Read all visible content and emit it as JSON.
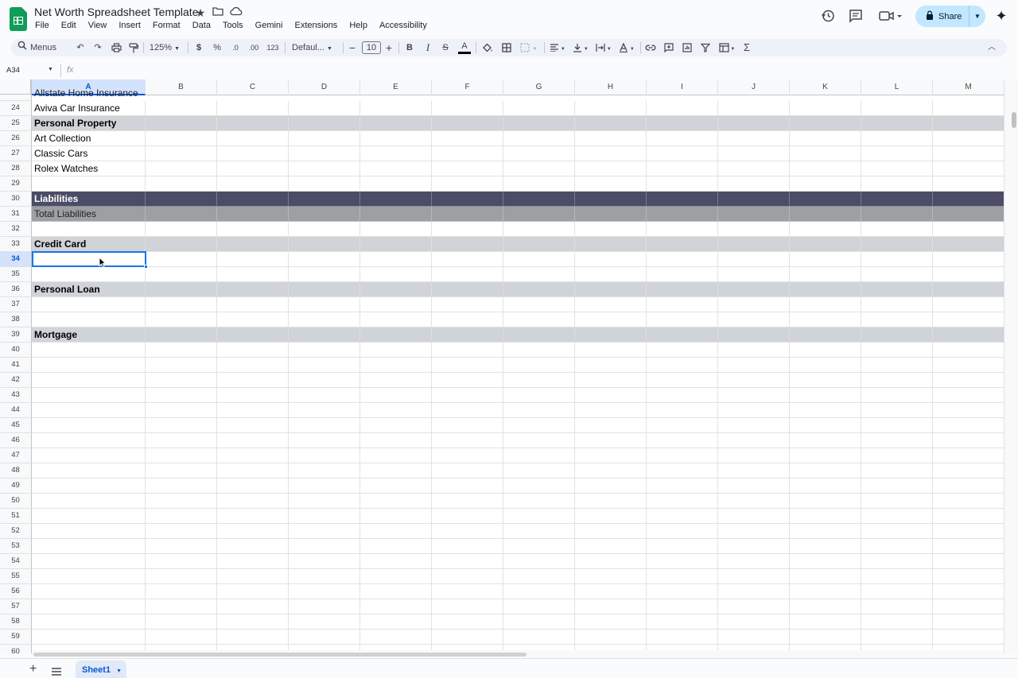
{
  "doc": {
    "title": "Net Worth Spreadsheet Template",
    "menus": [
      "File",
      "Edit",
      "View",
      "Insert",
      "Format",
      "Data",
      "Tools",
      "Gemini",
      "Extensions",
      "Help",
      "Accessibility"
    ],
    "share_label": "Share"
  },
  "icons": {
    "star": "★",
    "folder": "▭",
    "cloud": "☁",
    "history": "⟲",
    "comments": "▤",
    "video": "▶",
    "lock": "🔒",
    "gemini": "✦"
  },
  "toolbar": {
    "search_placeholder": "Menus",
    "zoom": "125%",
    "currency": "$",
    "percent": "%",
    "decrease_decimal": ".0",
    "increase_decimal": ".00",
    "number_format": "123",
    "font": "Defaul...",
    "font_size": "10",
    "bold": "B",
    "italic": "I",
    "strikethrough": "S",
    "text_color": "A"
  },
  "formula_bar": {
    "name_box": "A34",
    "fx": "fx",
    "value": ""
  },
  "grid": {
    "columns": [
      "A",
      "B",
      "C",
      "D",
      "E",
      "F",
      "G",
      "H",
      "I",
      "J",
      "K",
      "L",
      "M"
    ],
    "selected_column": "A",
    "selected_row": "34",
    "partial_top_text": "Allstate Home Insurance",
    "rows": [
      {
        "num": "24",
        "text": "Aviva Car Insurance",
        "style": "normal"
      },
      {
        "num": "25",
        "text": "Personal Property",
        "style": "section"
      },
      {
        "num": "26",
        "text": "Art Collection",
        "style": "normal"
      },
      {
        "num": "27",
        "text": "Classic Cars",
        "style": "normal"
      },
      {
        "num": "28",
        "text": "Rolex Watches",
        "style": "normal"
      },
      {
        "num": "29",
        "text": "",
        "style": "normal"
      },
      {
        "num": "30",
        "text": "Liabilities",
        "style": "header"
      },
      {
        "num": "31",
        "text": "Total Liabilities",
        "style": "total"
      },
      {
        "num": "32",
        "text": "",
        "style": "normal"
      },
      {
        "num": "33",
        "text": "Credit Card",
        "style": "section"
      },
      {
        "num": "34",
        "text": "",
        "style": "normal"
      },
      {
        "num": "35",
        "text": "",
        "style": "normal"
      },
      {
        "num": "36",
        "text": "Personal Loan",
        "style": "section"
      },
      {
        "num": "37",
        "text": "",
        "style": "normal"
      },
      {
        "num": "38",
        "text": "",
        "style": "normal"
      },
      {
        "num": "39",
        "text": "Mortgage",
        "style": "section"
      },
      {
        "num": "40",
        "text": "",
        "style": "normal"
      },
      {
        "num": "41",
        "text": "",
        "style": "normal"
      },
      {
        "num": "42",
        "text": "",
        "style": "normal"
      },
      {
        "num": "43",
        "text": "",
        "style": "normal"
      },
      {
        "num": "44",
        "text": "",
        "style": "normal"
      },
      {
        "num": "45",
        "text": "",
        "style": "normal"
      },
      {
        "num": "46",
        "text": "",
        "style": "normal"
      },
      {
        "num": "47",
        "text": "",
        "style": "normal"
      },
      {
        "num": "48",
        "text": "",
        "style": "normal"
      },
      {
        "num": "49",
        "text": "",
        "style": "normal"
      },
      {
        "num": "50",
        "text": "",
        "style": "normal"
      },
      {
        "num": "51",
        "text": "",
        "style": "normal"
      },
      {
        "num": "52",
        "text": "",
        "style": "normal"
      },
      {
        "num": "53",
        "text": "",
        "style": "normal"
      },
      {
        "num": "54",
        "text": "",
        "style": "normal"
      },
      {
        "num": "55",
        "text": "",
        "style": "normal"
      },
      {
        "num": "56",
        "text": "",
        "style": "normal"
      },
      {
        "num": "57",
        "text": "",
        "style": "normal"
      },
      {
        "num": "58",
        "text": "",
        "style": "normal"
      },
      {
        "num": "59",
        "text": "",
        "style": "normal"
      },
      {
        "num": "60",
        "text": "",
        "style": "normal"
      }
    ]
  },
  "colors": {
    "section_bg": "#d0d3d8",
    "header_bg": "#4b4d66",
    "total_bg": "#9d9fa3",
    "accent": "#1a73e8"
  },
  "sheets": {
    "active": "Sheet1"
  }
}
